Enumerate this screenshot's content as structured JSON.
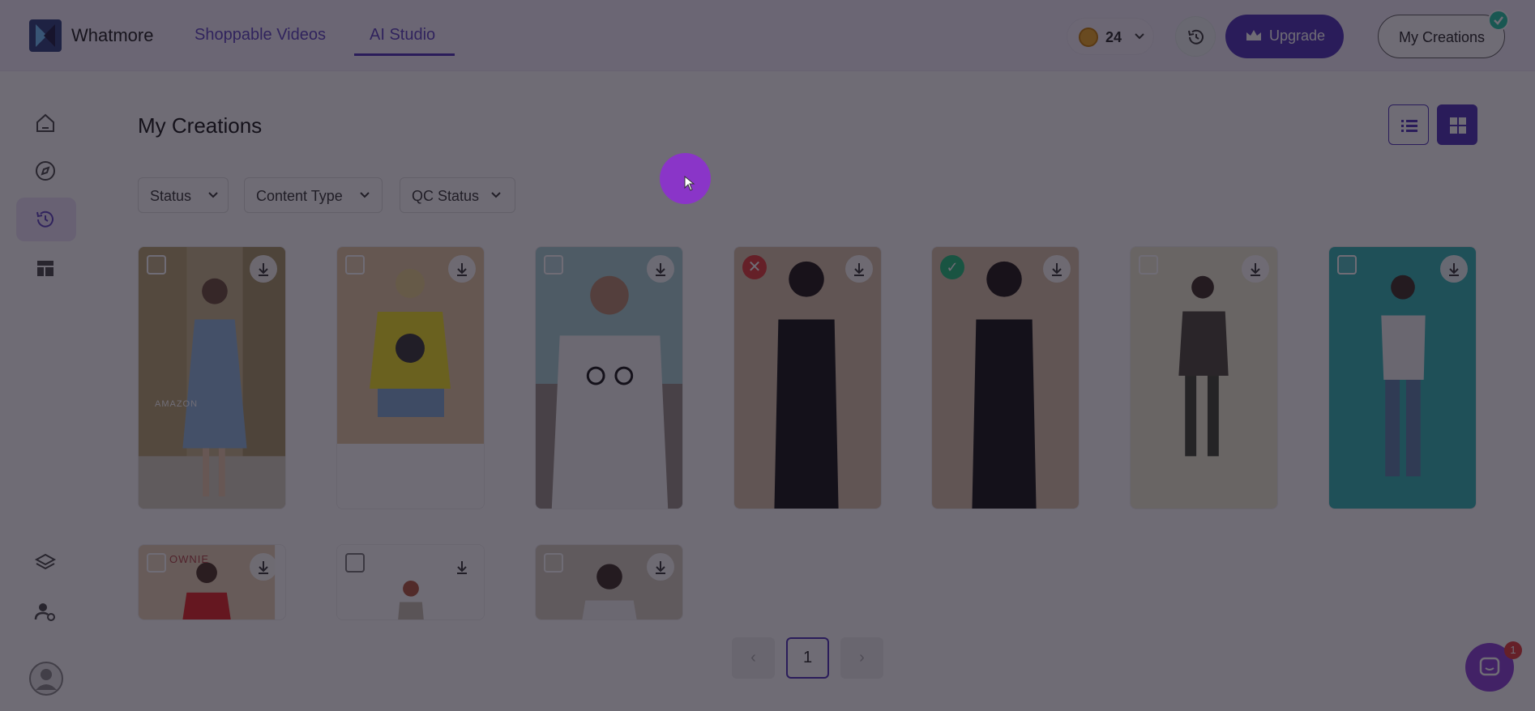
{
  "header": {
    "brand": "Whatmore",
    "tabs": [
      {
        "label": "Shoppable Videos"
      },
      {
        "label": "AI Studio"
      }
    ],
    "credits": "24",
    "upgrade_label": "Upgrade",
    "my_creations_label": "My Creations"
  },
  "sidebar": {
    "items": [
      {
        "icon": "home-icon"
      },
      {
        "icon": "compass-icon"
      },
      {
        "icon": "history-icon",
        "active": true
      },
      {
        "icon": "layout-icon"
      },
      {
        "icon": "layers-icon"
      },
      {
        "icon": "user-settings-icon"
      },
      {
        "icon": "avatar-icon"
      }
    ]
  },
  "main": {
    "title": "My Creations",
    "filters": [
      {
        "label": "Status"
      },
      {
        "label": "Content Type"
      },
      {
        "label": "QC Status"
      }
    ],
    "cards_row1": [
      {
        "caption": "AMAZON",
        "status": "none"
      },
      {
        "caption": "",
        "status": "none"
      },
      {
        "caption": "",
        "status": "none"
      },
      {
        "caption": "",
        "status": "rejected"
      },
      {
        "caption": "",
        "status": "approved"
      },
      {
        "caption": "",
        "status": "none"
      },
      {
        "caption": "",
        "status": "none"
      }
    ],
    "cards_row2": [
      {
        "caption": "OWNIE",
        "status": "none"
      },
      {
        "caption": "",
        "status": "none"
      },
      {
        "caption": "",
        "status": "none"
      }
    ],
    "pagination": {
      "prev": "‹",
      "current": "1",
      "next": "›"
    }
  },
  "chat_badge": "1",
  "colors": {
    "accent": "#4b2fb8",
    "approved": "#1fbf7a",
    "rejected": "#e53935"
  }
}
